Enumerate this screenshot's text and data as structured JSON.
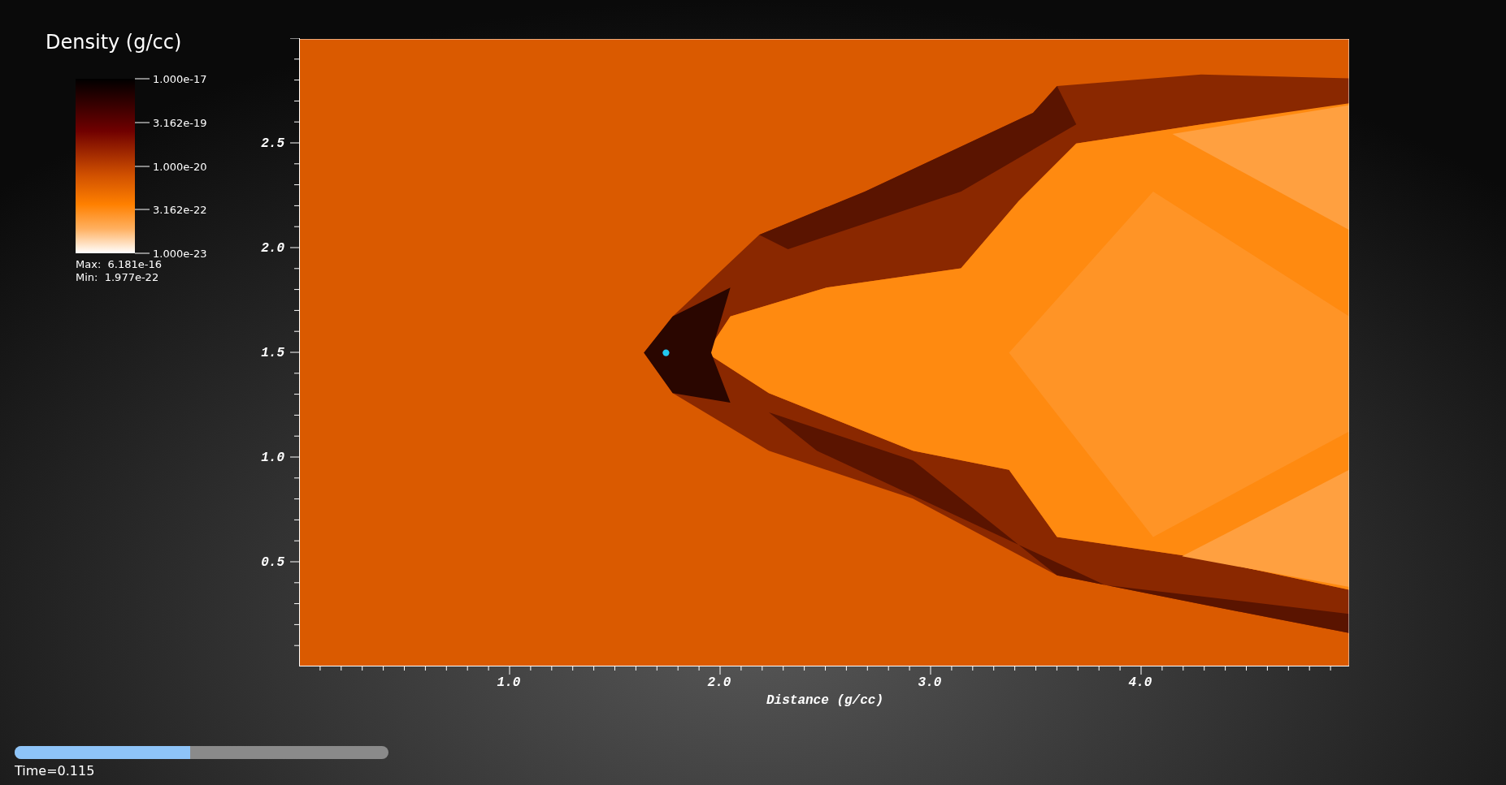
{
  "legend": {
    "title": "Density (g/cc)",
    "tick_labels": [
      "1.000e-17",
      "3.162e-19",
      "1.000e-20",
      "3.162e-22",
      "1.000e-23"
    ],
    "max": "Max:  6.181e-16",
    "min": "Min:  1.977e-22"
  },
  "plot": {
    "y_ticks": [
      "2.5",
      "2.0",
      "1.5",
      "1.0",
      "0.5"
    ],
    "x_ticks": [
      "1.0",
      "2.0",
      "3.0",
      "4.0"
    ],
    "x_label": "Distance (g/cc)"
  },
  "time_slider": {
    "level": 0.47,
    "label": "Time=0.115"
  }
}
